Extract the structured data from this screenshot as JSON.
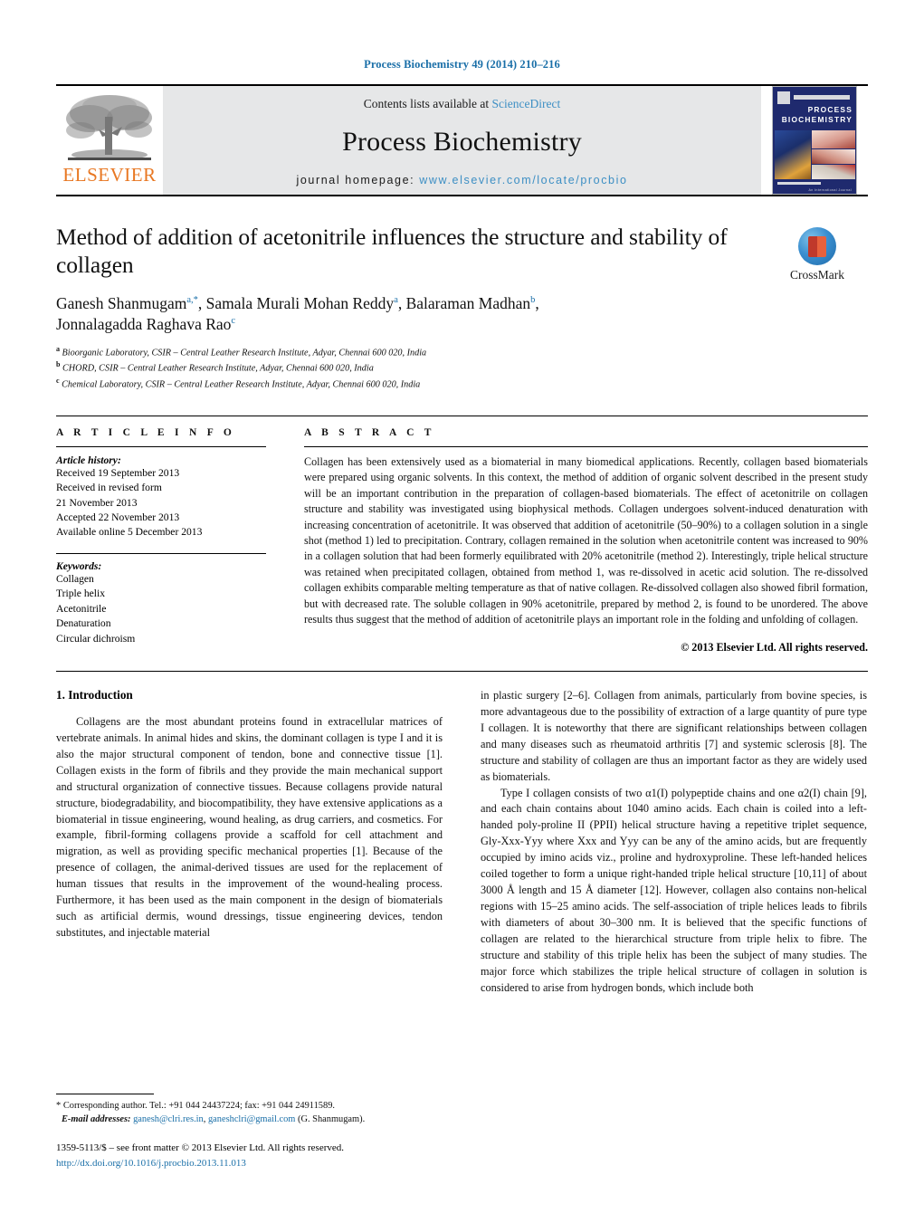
{
  "running_head": "Process Biochemistry 49 (2014) 210–216",
  "masthead": {
    "contents_prefix": "Contents lists available at ",
    "sciencedirect": "ScienceDirect",
    "journal_name": "Process Biochemistry",
    "homepage_prefix": "journal homepage: ",
    "homepage_url": "www.elsevier.com/locate/procbio",
    "publisher": "ELSEVIER",
    "publisher_logo_icon": "elsevier-tree-icon",
    "cover": {
      "line1": "PROCESS",
      "line2": "BIOCHEMISTRY",
      "footer": "An International Journal"
    },
    "accent_blue": "#3d8fc4",
    "elsevier_orange": "#e87722",
    "band_gray": "#e6e7e8"
  },
  "article": {
    "title": "Method of addition of acetonitrile influences the structure and stability of collagen",
    "authors": [
      {
        "name": "Ganesh Shanmugam",
        "marks": "a,*"
      },
      {
        "name": "Samala Murali Mohan Reddy",
        "marks": "a"
      },
      {
        "name": "Balaraman Madhan",
        "marks": "b"
      },
      {
        "name": "Jonnalagadda Raghava Rao",
        "marks": "c"
      }
    ],
    "affiliations": [
      {
        "mark": "a",
        "text": "Bioorganic Laboratory, CSIR – Central Leather Research Institute, Adyar, Chennai 600 020, India"
      },
      {
        "mark": "b",
        "text": "CHORD, CSIR – Central Leather Research Institute, Adyar, Chennai 600 020, India"
      },
      {
        "mark": "c",
        "text": "Chemical Laboratory, CSIR – Central Leather Research Institute, Adyar, Chennai 600 020, India"
      }
    ],
    "crossmark_label": "CrossMark",
    "crossmark_icon": "crossmark-badge-icon"
  },
  "article_info": {
    "heading": "A R T I C L E   I N F O",
    "history_label": "Article history:",
    "history": [
      "Received 19 September 2013",
      "Received in revised form",
      "21 November 2013",
      "Accepted 22 November 2013",
      "Available online 5 December 2013"
    ],
    "keywords_label": "Keywords:",
    "keywords": [
      "Collagen",
      "Triple helix",
      "Acetonitrile",
      "Denaturation",
      "Circular dichroism"
    ]
  },
  "abstract": {
    "heading": "A B S T R A C T",
    "text": "Collagen has been extensively used as a biomaterial in many biomedical applications. Recently, collagen based biomaterials were prepared using organic solvents. In this context, the method of addition of organic solvent described in the present study will be an important contribution in the preparation of collagen-based biomaterials. The effect of acetonitrile on collagen structure and stability was investigated using biophysical methods. Collagen undergoes solvent-induced denaturation with increasing concentration of acetonitrile. It was observed that addition of acetonitrile (50–90%) to a collagen solution in a single shot (method 1) led to precipitation. Contrary, collagen remained in the solution when acetonitrile content was increased to 90% in a collagen solution that had been formerly equilibrated with 20% acetonitrile (method 2). Interestingly, triple helical structure was retained when precipitated collagen, obtained from method 1, was re-dissolved in acetic acid solution. The re-dissolved collagen exhibits comparable melting temperature as that of native collagen. Re-dissolved collagen also showed fibril formation, but with decreased rate. The soluble collagen in 90% acetonitrile, prepared by method 2, is found to be unordered. The above results thus suggest that the method of addition of acetonitrile plays an important role in the folding and unfolding of collagen.",
    "copyright": "© 2013 Elsevier Ltd. All rights reserved."
  },
  "body": {
    "section_number_title": "1.  Introduction",
    "left_paragraphs": [
      "Collagens are the most abundant proteins found in extracellular matrices of vertebrate animals. In animal hides and skins, the dominant collagen is type I and it is also the major structural component of tendon, bone and connective tissue [1]. Collagen exists in the form of fibrils and they provide the main mechanical support and structural organization of connective tissues. Because collagens provide natural structure, biodegradability, and biocompatibility, they have extensive applications as a biomaterial in tissue engineering, wound healing, as drug carriers, and cosmetics. For example, fibril-forming collagens provide a scaffold for cell attachment and migration, as well as providing specific mechanical properties [1]. Because of the presence of collagen, the animal-derived tissues are used for the replacement of human tissues that results in the improvement of the wound-healing process. Furthermore, it has been used as the main component in the design of biomaterials such as artificial dermis, wound dressings, tissue engineering devices, tendon substitutes, and injectable material"
    ],
    "right_paragraphs": [
      "in plastic surgery [2–6]. Collagen from animals, particularly from bovine species, is more advantageous due to the possibility of extraction of a large quantity of pure type I collagen. It is noteworthy that there are significant relationships between collagen and many diseases such as rheumatoid arthritis [7] and systemic sclerosis [8]. The structure and stability of collagen are thus an important factor as they are widely used as biomaterials.",
      "Type I collagen consists of two α1(I) polypeptide chains and one α2(I) chain [9], and each chain contains about 1040 amino acids. Each chain is coiled into a left-handed poly-proline II (PPII) helical structure having a repetitive triplet sequence, Gly-Xxx-Yyy where Xxx and Yyy can be any of the amino acids, but are frequently occupied by imino acids viz., proline and hydroxyproline. These left-handed helices coiled together to form a unique right-handed triple helical structure [10,11] of about 3000 Å length and 15 Å diameter [12]. However, collagen also contains non-helical regions with 15–25 amino acids. The self-association of triple helices leads to fibrils with diameters of about 30–300 nm. It is believed that the specific functions of collagen are related to the hierarchical structure from triple helix to fibre. The structure and stability of this triple helix has been the subject of many studies. The major force which stabilizes the triple helical structure of collagen in solution is considered to arise from hydrogen bonds, which include both"
    ]
  },
  "footer": {
    "corresponding_star": "*",
    "corresponding_text": "Corresponding author. Tel.: +91 044 24437224; fax: +91 044 24911589.",
    "email_label": "E-mail addresses:",
    "email_1": "ganesh@clri.res.in",
    "email_separator": ", ",
    "email_2": "ganeshclri@gmail.com",
    "email_owner": "(G. Shanmugam).",
    "issn_line": "1359-5113/$ – see front matter © 2013 Elsevier Ltd. All rights reserved.",
    "doi": "http://dx.doi.org/10.1016/j.procbio.2013.11.013"
  }
}
